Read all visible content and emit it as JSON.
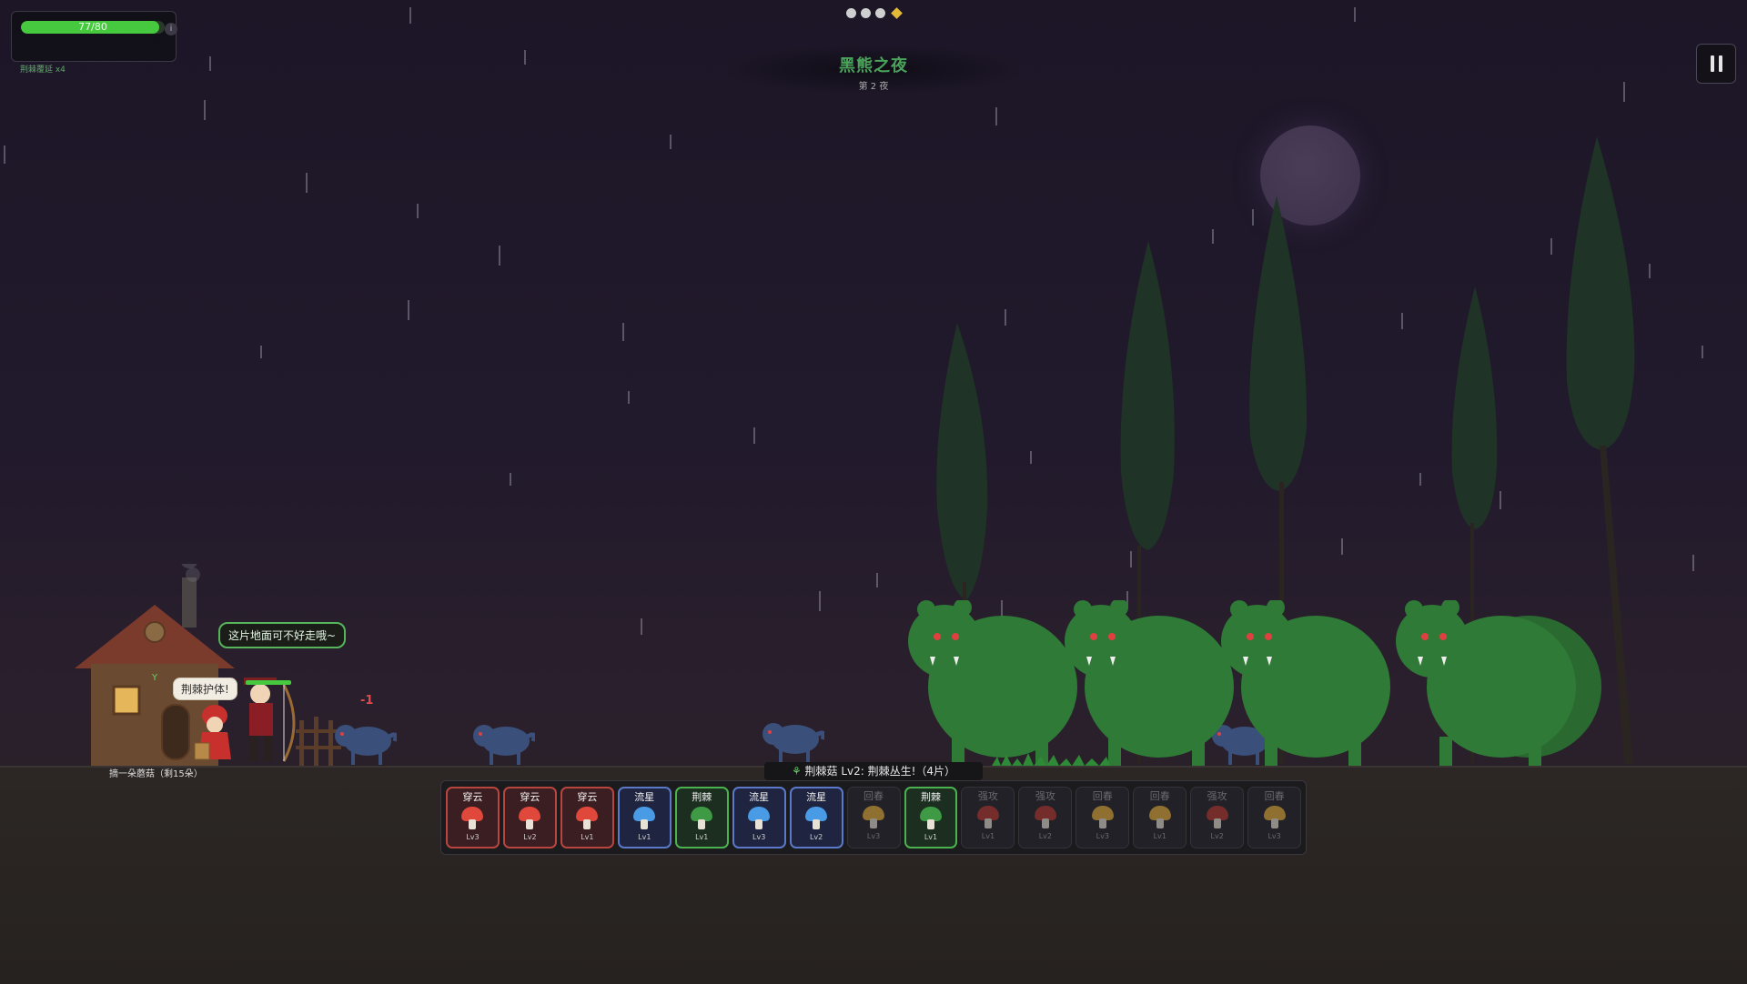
{
  "hud": {
    "hp_text": "77/80",
    "hp_fraction": 0.9625,
    "info_icon": "i",
    "buff_text": "荆棘覆延 x4"
  },
  "level": {
    "title": "黑熊之夜",
    "subtitle": "第 2 夜",
    "progress_dots": 3,
    "progress_marker": "diamond"
  },
  "scene": {
    "bubble_ground": "这片地面可不好走哦~",
    "bubble_thorn": "荆棘护体!",
    "damage_text": "-1",
    "house_label": "摘一朵蘑菇（剩15朵）",
    "status_banner": "荆棘菇 Lv2: 荆棘丛生!（4片）"
  },
  "colors": {
    "hp": "#47c93f",
    "title": "#4aa35a",
    "red_mushroom": "#d9463a",
    "blue_mushroom": "#4a8fdc",
    "green_mushroom": "#3e9a44",
    "yellow_mushroom": "#e8b23a",
    "bear": "#2f7a36"
  },
  "cards": [
    {
      "name": "穿云",
      "level": "Lv3",
      "type": "red",
      "color": "#e0483b",
      "active": true
    },
    {
      "name": "穿云",
      "level": "Lv2",
      "type": "red",
      "color": "#e0483b",
      "active": true
    },
    {
      "name": "穿云",
      "level": "Lv1",
      "type": "red",
      "color": "#e0483b",
      "active": true
    },
    {
      "name": "流星",
      "level": "Lv1",
      "type": "blue",
      "color": "#4a9be6",
      "active": true
    },
    {
      "name": "荆棘",
      "level": "Lv1",
      "type": "green",
      "color": "#3e9a44",
      "active": true
    },
    {
      "name": "流星",
      "level": "Lv3",
      "type": "blue",
      "color": "#4a9be6",
      "active": true
    },
    {
      "name": "流星",
      "level": "Lv2",
      "type": "blue",
      "color": "#4a9be6",
      "active": true
    },
    {
      "name": "回春",
      "level": "Lv3",
      "type": "gray",
      "color": "#e8b23a",
      "active": false
    },
    {
      "name": "荆棘",
      "level": "Lv1",
      "type": "green",
      "color": "#3e9a44",
      "active": true
    },
    {
      "name": "强攻",
      "level": "Lv1",
      "type": "gray",
      "color": "#b8382e",
      "active": false
    },
    {
      "name": "强攻",
      "level": "Lv2",
      "type": "gray",
      "color": "#b8382e",
      "active": false
    },
    {
      "name": "回春",
      "level": "Lv3",
      "type": "gray",
      "color": "#e8b23a",
      "active": false
    },
    {
      "name": "回春",
      "level": "Lv1",
      "type": "gray",
      "color": "#e8b23a",
      "active": false
    },
    {
      "name": "强攻",
      "level": "Lv2",
      "type": "gray",
      "color": "#b8382e",
      "active": false
    },
    {
      "name": "回春",
      "level": "Lv3",
      "type": "gray",
      "color": "#e8b23a",
      "active": false
    }
  ]
}
